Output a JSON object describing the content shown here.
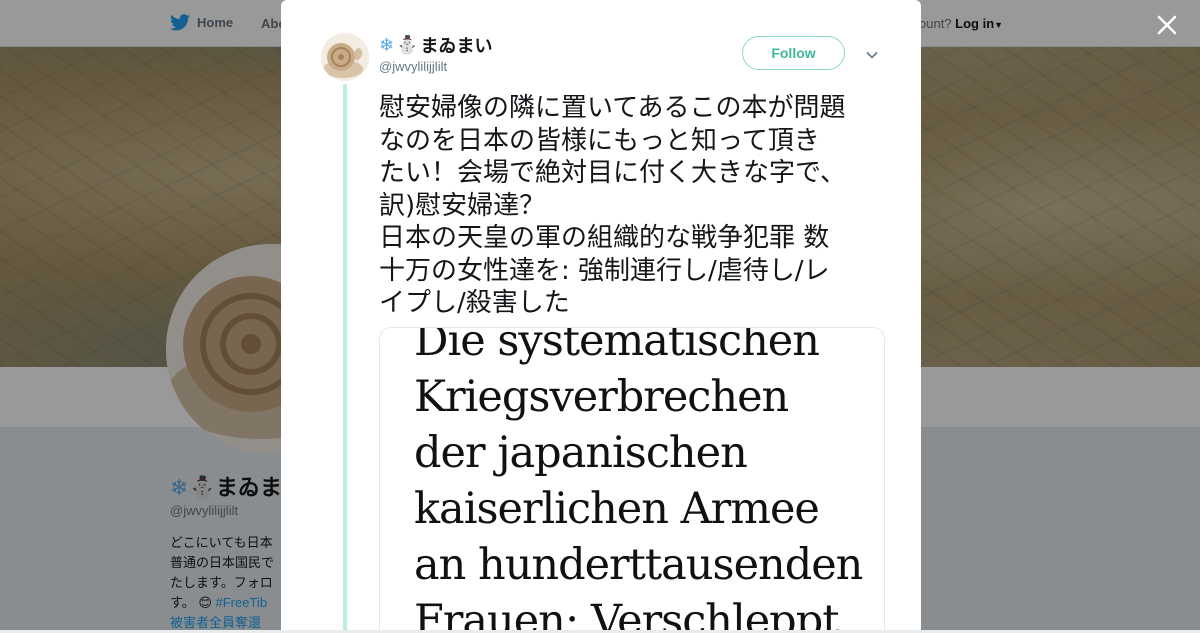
{
  "nav": {
    "home_label": "Home",
    "about_label": "Abo",
    "account_text": "ccount?",
    "login_label": "Log in"
  },
  "profile": {
    "name": "まゐまい",
    "handle": "@jwvylilijjlilt",
    "bio_lines": [
      "どこにいても日本",
      "普通の日本国民で",
      "たします。フォロ",
      "す。"
    ],
    "bio_hashtag": "#FreeTib",
    "bio_last": "被害者全員奪還"
  },
  "tweet": {
    "author_name": "まゐまい",
    "author_handle": "@jwvylilijjlilt",
    "follow_label": "Follow",
    "text": "慰安婦像の隣に置いてあるこの本が問題\nなのを日本の皆様にもっと知って頂き\nたい！会場で絶対目に付く大きな字で、\n訳)慰安婦達？\n日本の天皇の軍の組織的な戦争犯罪 数\n十万の女性達を: 強制連行し/虐待し/レ\nイプし/殺害した",
    "media_lines": [
      "Die systematischen",
      "Kriegsverbrechen",
      "der japanischen",
      "kaiserlichen Armee",
      "an hunderttausenden",
      "Frauen: Verschleppt"
    ]
  },
  "colors": {
    "accent": "#1da1f2",
    "follow_border": "#8ad9c6",
    "follow_text": "#3fb79c",
    "thread_line": "#bdeedb"
  },
  "icons": [
    "twitter-bird-icon",
    "snowflake-icon",
    "snowman-icon",
    "chevron-down-icon",
    "close-icon",
    "smile-emoji-icon"
  ]
}
